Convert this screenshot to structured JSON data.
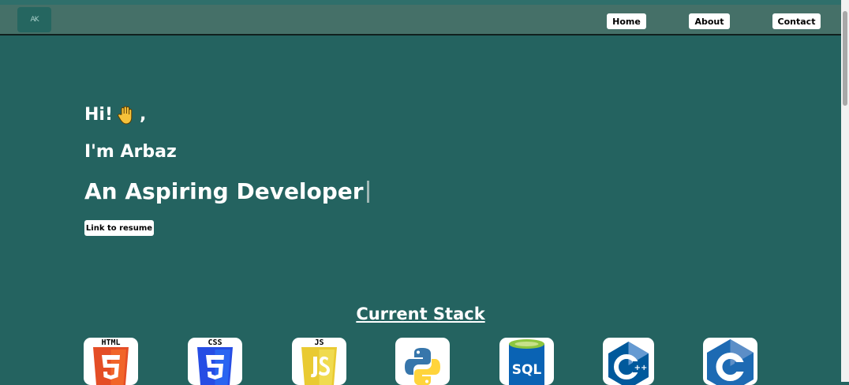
{
  "nav": {
    "logo_text": "AK",
    "items": [
      {
        "label": "Home"
      },
      {
        "label": "About"
      },
      {
        "label": "Contact"
      }
    ]
  },
  "hero": {
    "greeting": "Hi!",
    "greeting_suffix": ",",
    "greeting_icon": "raised-hand-icon",
    "name": "I'm Arbaz",
    "role": "An Aspiring Developer",
    "resume_label": "Link to resume"
  },
  "stack": {
    "title": "Current Stack",
    "items": [
      {
        "name": "HTML",
        "icon": "html5-icon",
        "color": "#e44d26"
      },
      {
        "name": "CSS",
        "icon": "css3-icon",
        "color": "#264de4"
      },
      {
        "name": "JS",
        "icon": "javascript-icon",
        "color": "#f0db4f"
      },
      {
        "name": "Python",
        "icon": "python-icon",
        "color": "#3776ab"
      },
      {
        "name": "SQL",
        "icon": "sql-icon",
        "color": "#0a63b4"
      },
      {
        "name": "C++",
        "icon": "cplusplus-icon",
        "color": "#00599c"
      },
      {
        "name": "C",
        "icon": "c-icon",
        "color": "#1d6ab3"
      }
    ]
  },
  "colors": {
    "page_bg": "#246360",
    "navbar_bg": "#457068"
  }
}
